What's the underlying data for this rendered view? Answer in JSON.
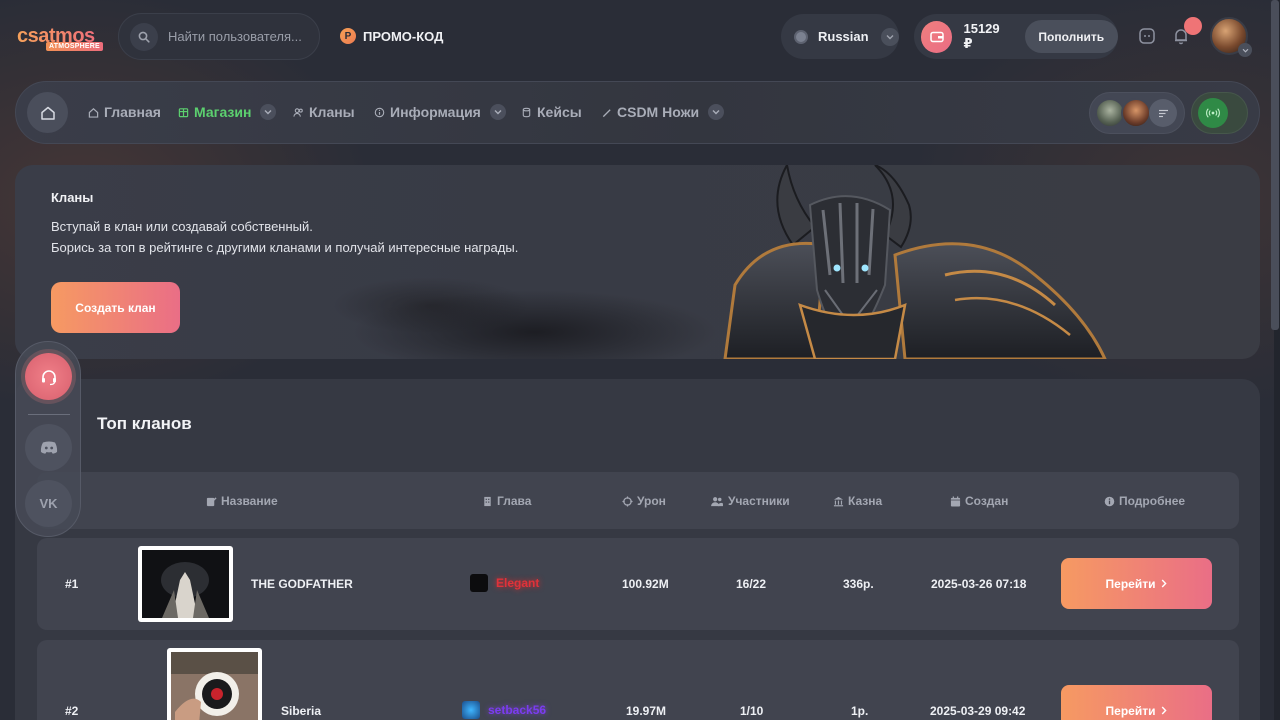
{
  "header": {
    "logo": "csatmos",
    "logo_sub": "ATMOSPHERE",
    "search_placeholder": "Найти пользователя...",
    "promo_icon": "P",
    "promo_label": "ПРОМО-КОД",
    "language": "Russian",
    "balance": "15129 ₽",
    "topup_label": "Пополнить"
  },
  "nav": {
    "items": [
      {
        "label": "Главная"
      },
      {
        "label": "Магазин"
      },
      {
        "label": "Кланы"
      },
      {
        "label": "Информация"
      },
      {
        "label": "Кейсы"
      },
      {
        "label": "CSDM Ножи"
      }
    ]
  },
  "banner": {
    "title": "Кланы",
    "line1": "Вступай в клан или создавай собственный.",
    "line2": "Борись за топ в рейтинге с другими кланами и получай интересные награды.",
    "create_label": "Создать клан"
  },
  "side": {
    "vk": "VK"
  },
  "clans": {
    "title": "Топ кланов",
    "columns": [
      "Название",
      "Глава",
      "Урон",
      "Участники",
      "Казна",
      "Создан",
      "Подробнее"
    ],
    "rows": [
      {
        "rank": "#1",
        "name": "THE GODFATHER",
        "leader": "Elegant",
        "damage": "100.92M",
        "members": "16/22",
        "treasury": "336р.",
        "created": "2025-03-26 07:18",
        "action": "Перейти"
      },
      {
        "rank": "#2",
        "name": "Siberia",
        "leader": "setback56",
        "damage": "19.97M",
        "members": "1/10",
        "treasury": "1р.",
        "created": "2025-03-29 09:42",
        "action": "Перейти"
      }
    ]
  },
  "colors": {
    "accent_start": "#f69a62",
    "accent_end": "#ea6e86",
    "nav_active": "#5cd06f",
    "leader1": "#e0323a",
    "leader2": "#7b3cf0"
  },
  "icons": [
    "search-icon",
    "promo-icon",
    "globe-icon",
    "wallet-icon",
    "chat-icon",
    "bell-icon",
    "home-icon",
    "shop-icon",
    "clan-icon",
    "info-icon",
    "case-icon",
    "knife-icon",
    "filter-icon",
    "broadcast-icon",
    "headset-icon",
    "discord-icon",
    "vk-icon"
  ]
}
